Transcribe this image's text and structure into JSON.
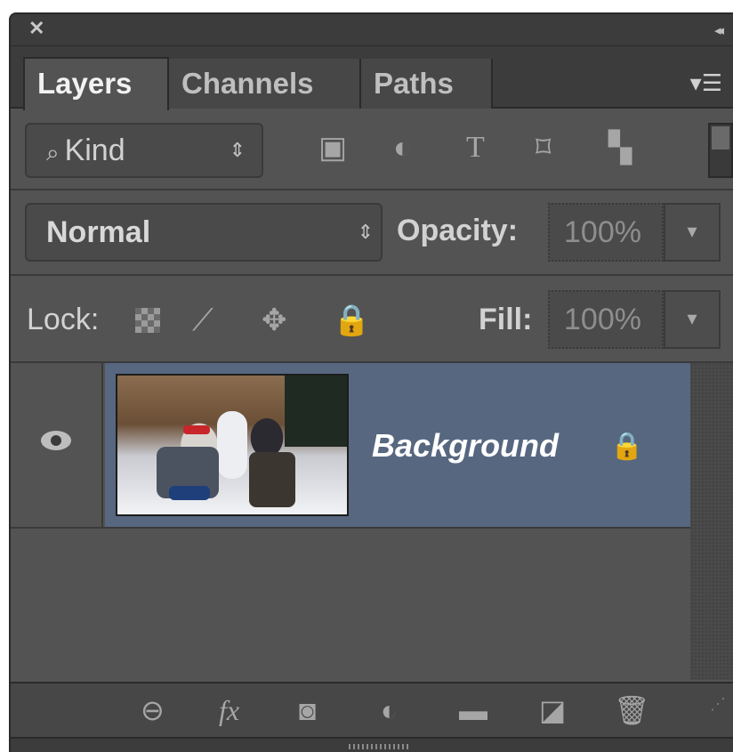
{
  "window": {
    "close_glyph": "✕",
    "collapse_glyph": "◂◂"
  },
  "tabs": [
    {
      "label": "Layers",
      "active": true
    },
    {
      "label": "Channels",
      "active": false
    },
    {
      "label": "Paths",
      "active": false
    }
  ],
  "panel_menu_icon": "panel-menu-icon",
  "filter": {
    "kind_label": "Kind",
    "kind_icon": "search-icon",
    "filter_icons": [
      "pixel-layer-filter-icon",
      "adjustment-layer-filter-icon",
      "type-layer-filter-icon",
      "shape-layer-filter-icon",
      "smart-object-filter-icon"
    ],
    "type_glyph": "T"
  },
  "blend": {
    "mode": "Normal",
    "opacity_label": "Opacity:",
    "opacity_value": "100%"
  },
  "lock": {
    "label": "Lock:",
    "icons": [
      "lock-transparent-pixels-icon",
      "lock-image-pixels-icon",
      "lock-position-icon",
      "lock-all-icon"
    ],
    "fill_label": "Fill:",
    "fill_value": "100%"
  },
  "layers": [
    {
      "name": "Background",
      "visible": true,
      "locked": true,
      "selected": true
    }
  ],
  "bottom_toolbar": {
    "icons": [
      "link-layers-icon",
      "fx-icon",
      "add-mask-icon",
      "new-adjustment-layer-icon",
      "new-group-icon",
      "new-layer-icon",
      "delete-layer-icon"
    ],
    "fx_label": "fx"
  },
  "colors": {
    "panel_bg": "#535353",
    "selection": "#576780",
    "text": "#d2d2d2"
  }
}
